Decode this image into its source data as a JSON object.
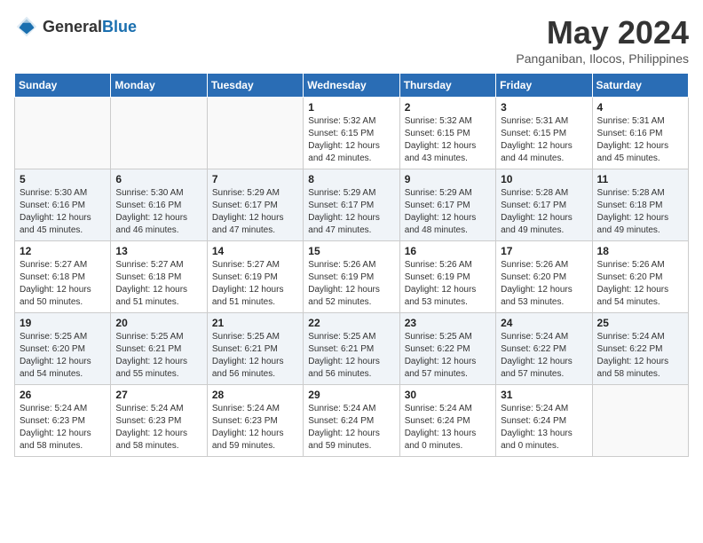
{
  "header": {
    "logo_general": "General",
    "logo_blue": "Blue",
    "month": "May 2024",
    "location": "Panganiban, Ilocos, Philippines"
  },
  "days_of_week": [
    "Sunday",
    "Monday",
    "Tuesday",
    "Wednesday",
    "Thursday",
    "Friday",
    "Saturday"
  ],
  "weeks": [
    [
      {
        "day": "",
        "info": ""
      },
      {
        "day": "",
        "info": ""
      },
      {
        "day": "",
        "info": ""
      },
      {
        "day": "1",
        "info": "Sunrise: 5:32 AM\nSunset: 6:15 PM\nDaylight: 12 hours\nand 42 minutes."
      },
      {
        "day": "2",
        "info": "Sunrise: 5:32 AM\nSunset: 6:15 PM\nDaylight: 12 hours\nand 43 minutes."
      },
      {
        "day": "3",
        "info": "Sunrise: 5:31 AM\nSunset: 6:15 PM\nDaylight: 12 hours\nand 44 minutes."
      },
      {
        "day": "4",
        "info": "Sunrise: 5:31 AM\nSunset: 6:16 PM\nDaylight: 12 hours\nand 45 minutes."
      }
    ],
    [
      {
        "day": "5",
        "info": "Sunrise: 5:30 AM\nSunset: 6:16 PM\nDaylight: 12 hours\nand 45 minutes."
      },
      {
        "day": "6",
        "info": "Sunrise: 5:30 AM\nSunset: 6:16 PM\nDaylight: 12 hours\nand 46 minutes."
      },
      {
        "day": "7",
        "info": "Sunrise: 5:29 AM\nSunset: 6:17 PM\nDaylight: 12 hours\nand 47 minutes."
      },
      {
        "day": "8",
        "info": "Sunrise: 5:29 AM\nSunset: 6:17 PM\nDaylight: 12 hours\nand 47 minutes."
      },
      {
        "day": "9",
        "info": "Sunrise: 5:29 AM\nSunset: 6:17 PM\nDaylight: 12 hours\nand 48 minutes."
      },
      {
        "day": "10",
        "info": "Sunrise: 5:28 AM\nSunset: 6:17 PM\nDaylight: 12 hours\nand 49 minutes."
      },
      {
        "day": "11",
        "info": "Sunrise: 5:28 AM\nSunset: 6:18 PM\nDaylight: 12 hours\nand 49 minutes."
      }
    ],
    [
      {
        "day": "12",
        "info": "Sunrise: 5:27 AM\nSunset: 6:18 PM\nDaylight: 12 hours\nand 50 minutes."
      },
      {
        "day": "13",
        "info": "Sunrise: 5:27 AM\nSunset: 6:18 PM\nDaylight: 12 hours\nand 51 minutes."
      },
      {
        "day": "14",
        "info": "Sunrise: 5:27 AM\nSunset: 6:19 PM\nDaylight: 12 hours\nand 51 minutes."
      },
      {
        "day": "15",
        "info": "Sunrise: 5:26 AM\nSunset: 6:19 PM\nDaylight: 12 hours\nand 52 minutes."
      },
      {
        "day": "16",
        "info": "Sunrise: 5:26 AM\nSunset: 6:19 PM\nDaylight: 12 hours\nand 53 minutes."
      },
      {
        "day": "17",
        "info": "Sunrise: 5:26 AM\nSunset: 6:20 PM\nDaylight: 12 hours\nand 53 minutes."
      },
      {
        "day": "18",
        "info": "Sunrise: 5:26 AM\nSunset: 6:20 PM\nDaylight: 12 hours\nand 54 minutes."
      }
    ],
    [
      {
        "day": "19",
        "info": "Sunrise: 5:25 AM\nSunset: 6:20 PM\nDaylight: 12 hours\nand 54 minutes."
      },
      {
        "day": "20",
        "info": "Sunrise: 5:25 AM\nSunset: 6:21 PM\nDaylight: 12 hours\nand 55 minutes."
      },
      {
        "day": "21",
        "info": "Sunrise: 5:25 AM\nSunset: 6:21 PM\nDaylight: 12 hours\nand 56 minutes."
      },
      {
        "day": "22",
        "info": "Sunrise: 5:25 AM\nSunset: 6:21 PM\nDaylight: 12 hours\nand 56 minutes."
      },
      {
        "day": "23",
        "info": "Sunrise: 5:25 AM\nSunset: 6:22 PM\nDaylight: 12 hours\nand 57 minutes."
      },
      {
        "day": "24",
        "info": "Sunrise: 5:24 AM\nSunset: 6:22 PM\nDaylight: 12 hours\nand 57 minutes."
      },
      {
        "day": "25",
        "info": "Sunrise: 5:24 AM\nSunset: 6:22 PM\nDaylight: 12 hours\nand 58 minutes."
      }
    ],
    [
      {
        "day": "26",
        "info": "Sunrise: 5:24 AM\nSunset: 6:23 PM\nDaylight: 12 hours\nand 58 minutes."
      },
      {
        "day": "27",
        "info": "Sunrise: 5:24 AM\nSunset: 6:23 PM\nDaylight: 12 hours\nand 58 minutes."
      },
      {
        "day": "28",
        "info": "Sunrise: 5:24 AM\nSunset: 6:23 PM\nDaylight: 12 hours\nand 59 minutes."
      },
      {
        "day": "29",
        "info": "Sunrise: 5:24 AM\nSunset: 6:24 PM\nDaylight: 12 hours\nand 59 minutes."
      },
      {
        "day": "30",
        "info": "Sunrise: 5:24 AM\nSunset: 6:24 PM\nDaylight: 13 hours\nand 0 minutes."
      },
      {
        "day": "31",
        "info": "Sunrise: 5:24 AM\nSunset: 6:24 PM\nDaylight: 13 hours\nand 0 minutes."
      },
      {
        "day": "",
        "info": ""
      }
    ]
  ]
}
